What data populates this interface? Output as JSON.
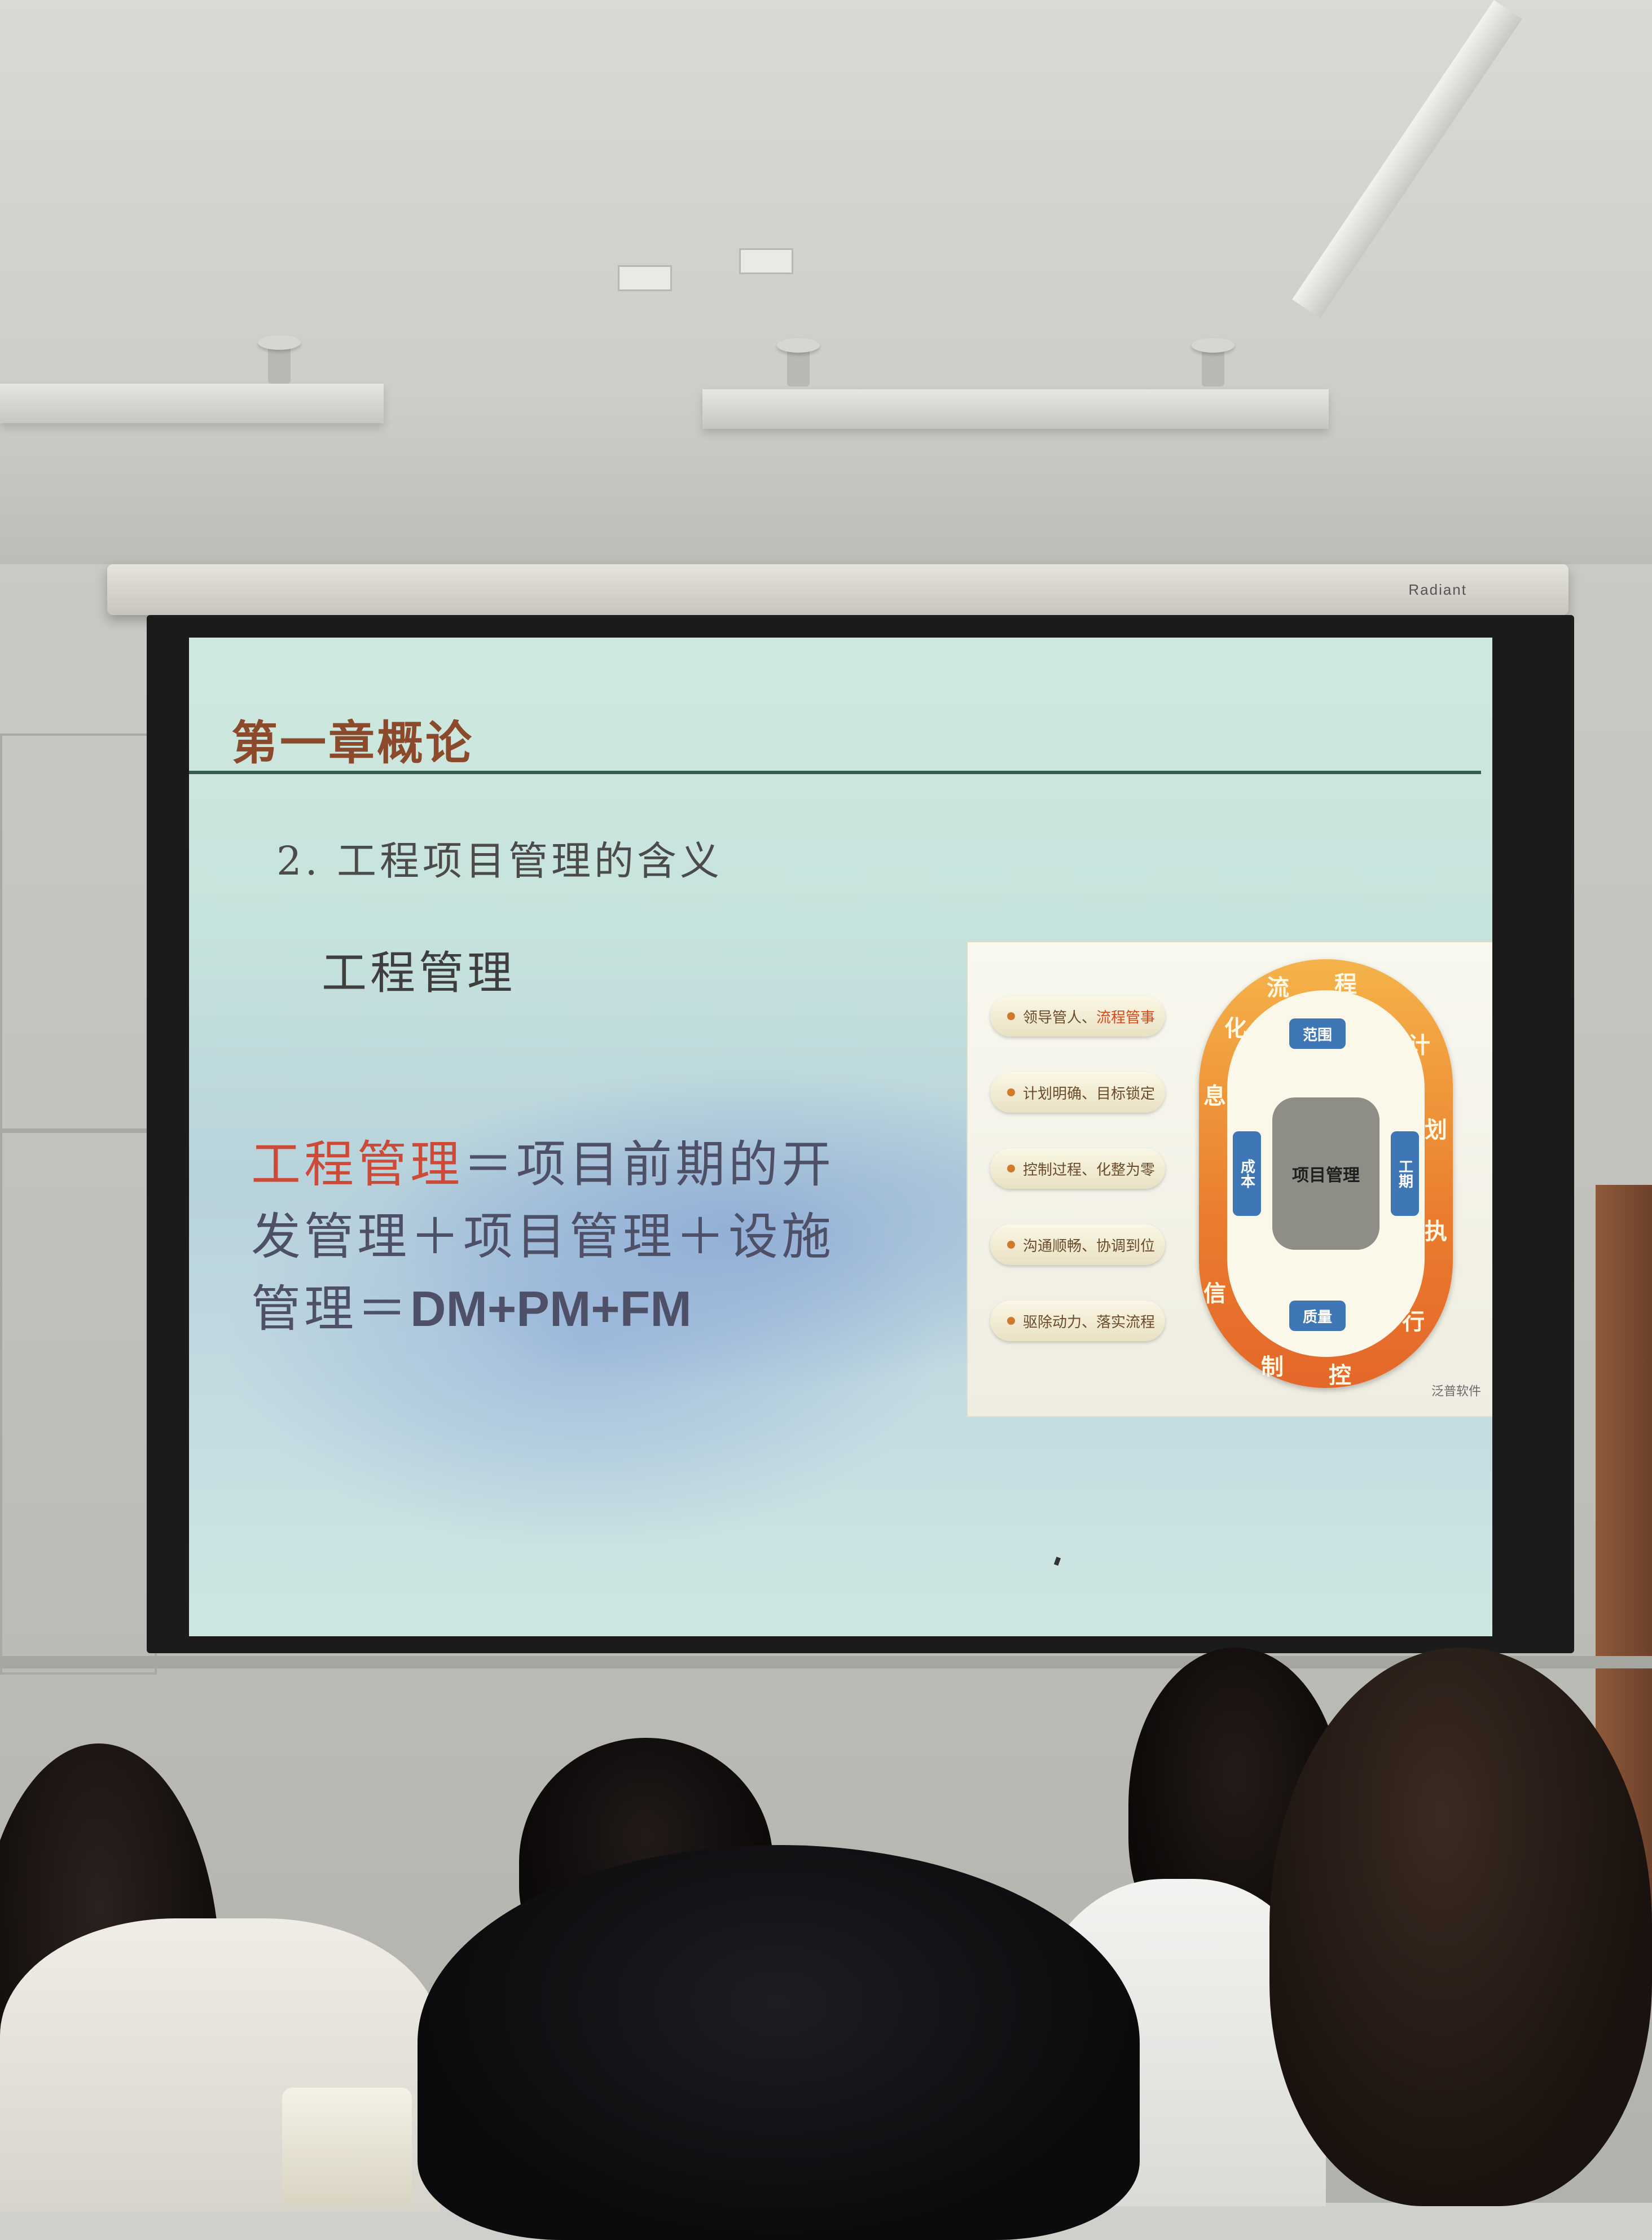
{
  "screen": {
    "brand": "Radiant"
  },
  "slide": {
    "title": "第一章概论",
    "subheading": "2. 工程项目管理的含义",
    "term": "工程管理",
    "definition": {
      "highlight": "工程管理",
      "line1_rest": "＝项目前期的开",
      "line2": "发管理＋项目管理＋设施",
      "line3_prefix": "管理＝",
      "formula": "DM+PM+FM"
    }
  },
  "diagram": {
    "pills": [
      {
        "text": "领导管人、",
        "accent": "流程管事"
      },
      {
        "text": "计划明确、目标锁定",
        "accent": ""
      },
      {
        "text": "控制过程、化整为零",
        "accent": ""
      },
      {
        "text": "沟通顺畅、协调到位",
        "accent": ""
      },
      {
        "text": "驱除动力、落实流程",
        "accent": ""
      }
    ],
    "center_label": "项目管理",
    "tags": {
      "top": "范围",
      "left": "成本",
      "right": "工期",
      "bottom": "质量"
    },
    "ring_chars": [
      "流",
      "程",
      "计",
      "划",
      "执",
      "行",
      "控",
      "制",
      "信",
      "息",
      "化"
    ],
    "brand": "泛普软件"
  }
}
